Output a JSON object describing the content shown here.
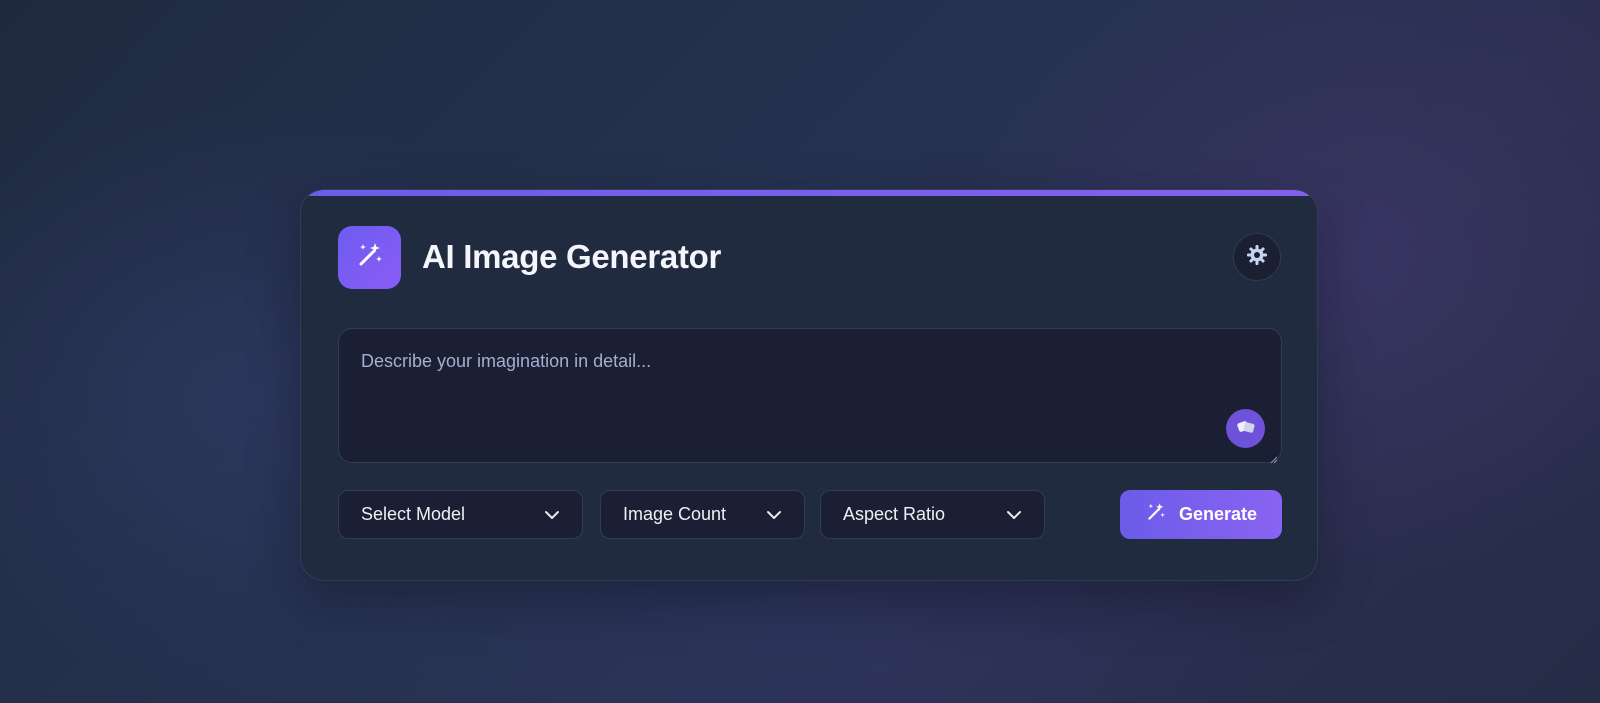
{
  "app": {
    "title": "AI Image Generator",
    "logo_icon": "magic-wand-icon",
    "theme_toggle_icon": "sun-gear-icon"
  },
  "prompt": {
    "placeholder": "Describe your imagination in detail...",
    "value": "",
    "random_prompt_icon": "dice-icon"
  },
  "controls": {
    "model_select": {
      "label": "Select Model",
      "icon": "chevron-down-icon"
    },
    "count_select": {
      "label": "Image Count",
      "icon": "chevron-down-icon"
    },
    "ratio_select": {
      "label": "Aspect Ratio",
      "icon": "chevron-down-icon"
    },
    "generate_button": {
      "label": "Generate",
      "icon": "magic-wand-icon"
    }
  },
  "colors": {
    "accent_start": "#6b5ee6",
    "accent_end": "#8a63f2",
    "card_bg": "#212b40",
    "input_bg": "#1a1f33"
  }
}
